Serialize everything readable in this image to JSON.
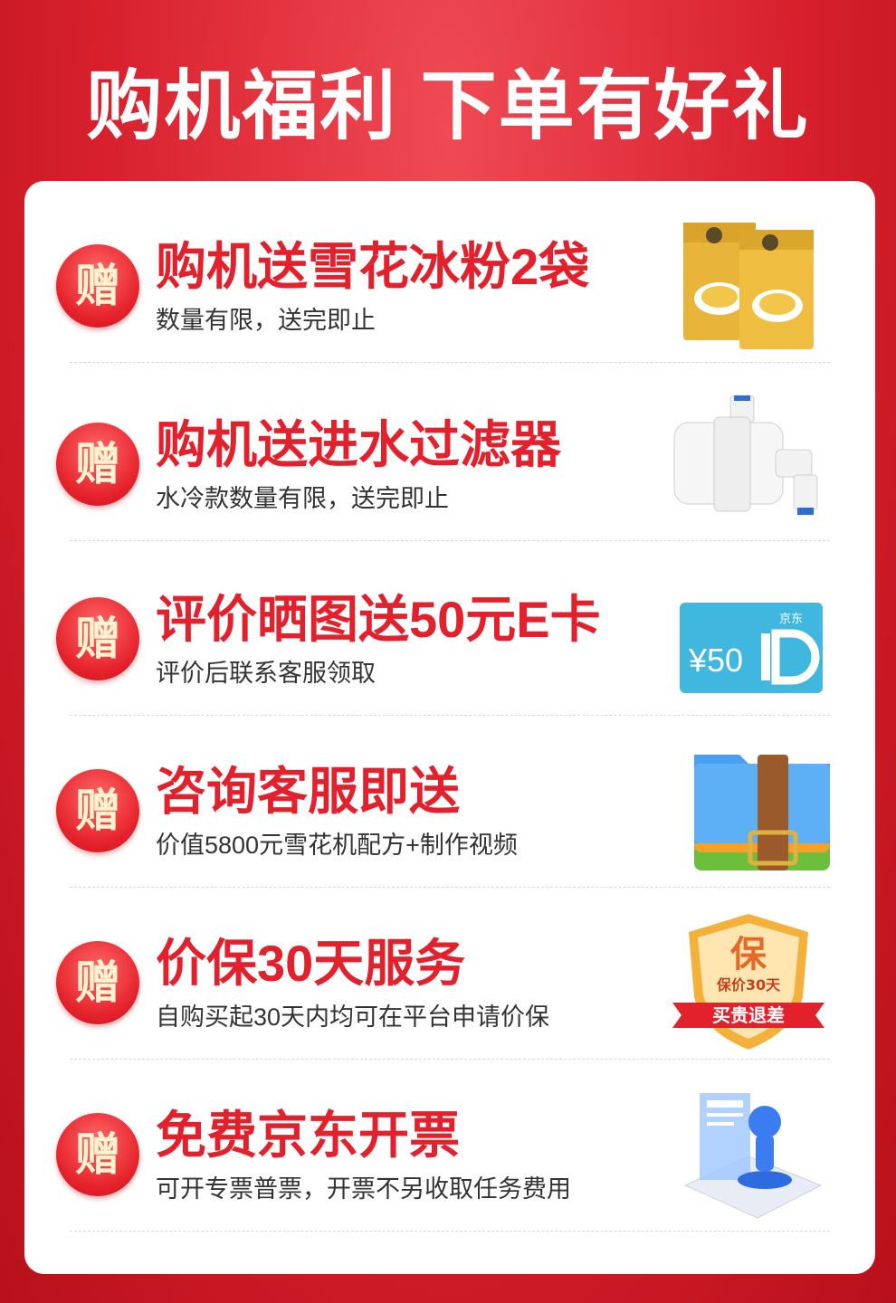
{
  "header": {
    "title": "购机福利 下单有好礼"
  },
  "colors": {
    "background": "#d8202d",
    "accent": "#e3212c",
    "card": "#ffffff"
  },
  "items": [
    {
      "badge": "赠",
      "title": "购机送雪花冰粉2袋",
      "subtitle": "数量有限，送完即止",
      "icon": "snow-ice-powder-bags-icon"
    },
    {
      "badge": "赠",
      "title": "购机送进水过滤器",
      "subtitle": "水冷款数量有限，送完即止",
      "icon": "water-filter-icon"
    },
    {
      "badge": "赠",
      "title": "评价晒图送50元E卡",
      "subtitle": "评价后联系客服领取",
      "icon": "jd-ecard-icon",
      "card_brand": "京东",
      "card_value": "¥50"
    },
    {
      "badge": "赠",
      "title": "咨询客服即送",
      "subtitle": "价值5800元雪花机配方+制作视频",
      "icon": "archive-box-icon"
    },
    {
      "badge": "赠",
      "title": "价保30天服务",
      "subtitle": "自购买起30天内均可在平台申请价保",
      "icon": "price-protection-shield-icon",
      "shield_text": "保",
      "shield_subtext": "保价30天",
      "ribbon_text": "买贵退差"
    },
    {
      "badge": "赠",
      "title": "免费京东开票",
      "subtitle": "可开专票普票，开票不另收取任务费用",
      "icon": "invoice-stamp-icon"
    }
  ]
}
